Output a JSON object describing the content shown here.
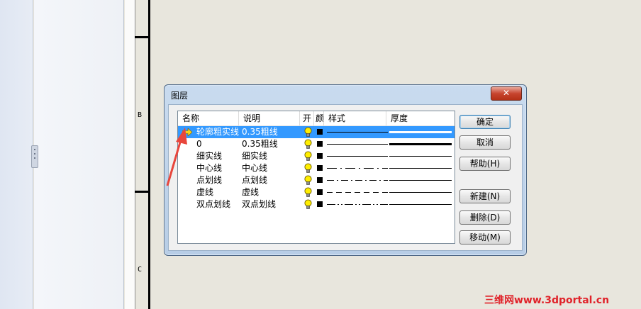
{
  "drawing": {
    "zone_labels": [
      "B",
      "C"
    ]
  },
  "dialog": {
    "title": "图层",
    "close_icon": "close-icon",
    "columns": [
      "名称",
      "说明",
      "开",
      "颜",
      "样式",
      "厚度"
    ],
    "rows": [
      {
        "name": "轮廓粗实线",
        "desc": "0.35粗线",
        "on": true,
        "color": "#000000",
        "style": "solid",
        "thickness": "thick",
        "current": true,
        "selected": true
      },
      {
        "name": "0",
        "desc": "0.35粗线",
        "on": true,
        "color": "#000000",
        "style": "solid",
        "thickness": "thick",
        "current": false,
        "selected": false
      },
      {
        "name": "细实线",
        "desc": "细实线",
        "on": true,
        "color": "#000000",
        "style": "solid",
        "thickness": "thin",
        "current": false,
        "selected": false
      },
      {
        "name": "中心线",
        "desc": "中心线",
        "on": true,
        "color": "#000000",
        "style": "dashdot",
        "thickness": "thin",
        "current": false,
        "selected": false
      },
      {
        "name": "点划线",
        "desc": "点划线",
        "on": true,
        "color": "#000000",
        "style": "dashdot2",
        "thickness": "thin",
        "current": false,
        "selected": false
      },
      {
        "name": "虚线",
        "desc": "虚线",
        "on": true,
        "color": "#000000",
        "style": "dashed",
        "thickness": "thin",
        "current": false,
        "selected": false
      },
      {
        "name": "双点划线",
        "desc": "双点划线",
        "on": true,
        "color": "#000000",
        "style": "dashdotdot",
        "thickness": "thin",
        "current": false,
        "selected": false
      }
    ],
    "buttons": {
      "ok": "确定",
      "cancel": "取消",
      "help": "帮助(H)",
      "new": "新建(N)",
      "delete": "删除(D)",
      "move": "移动(M)"
    }
  },
  "watermark": "三维网www.3dportal.cn",
  "colors": {
    "selection": "#3399ff",
    "bulb": "#ffee00",
    "annotation_arrow": "#e8463c",
    "watermark": "#e0232a"
  }
}
